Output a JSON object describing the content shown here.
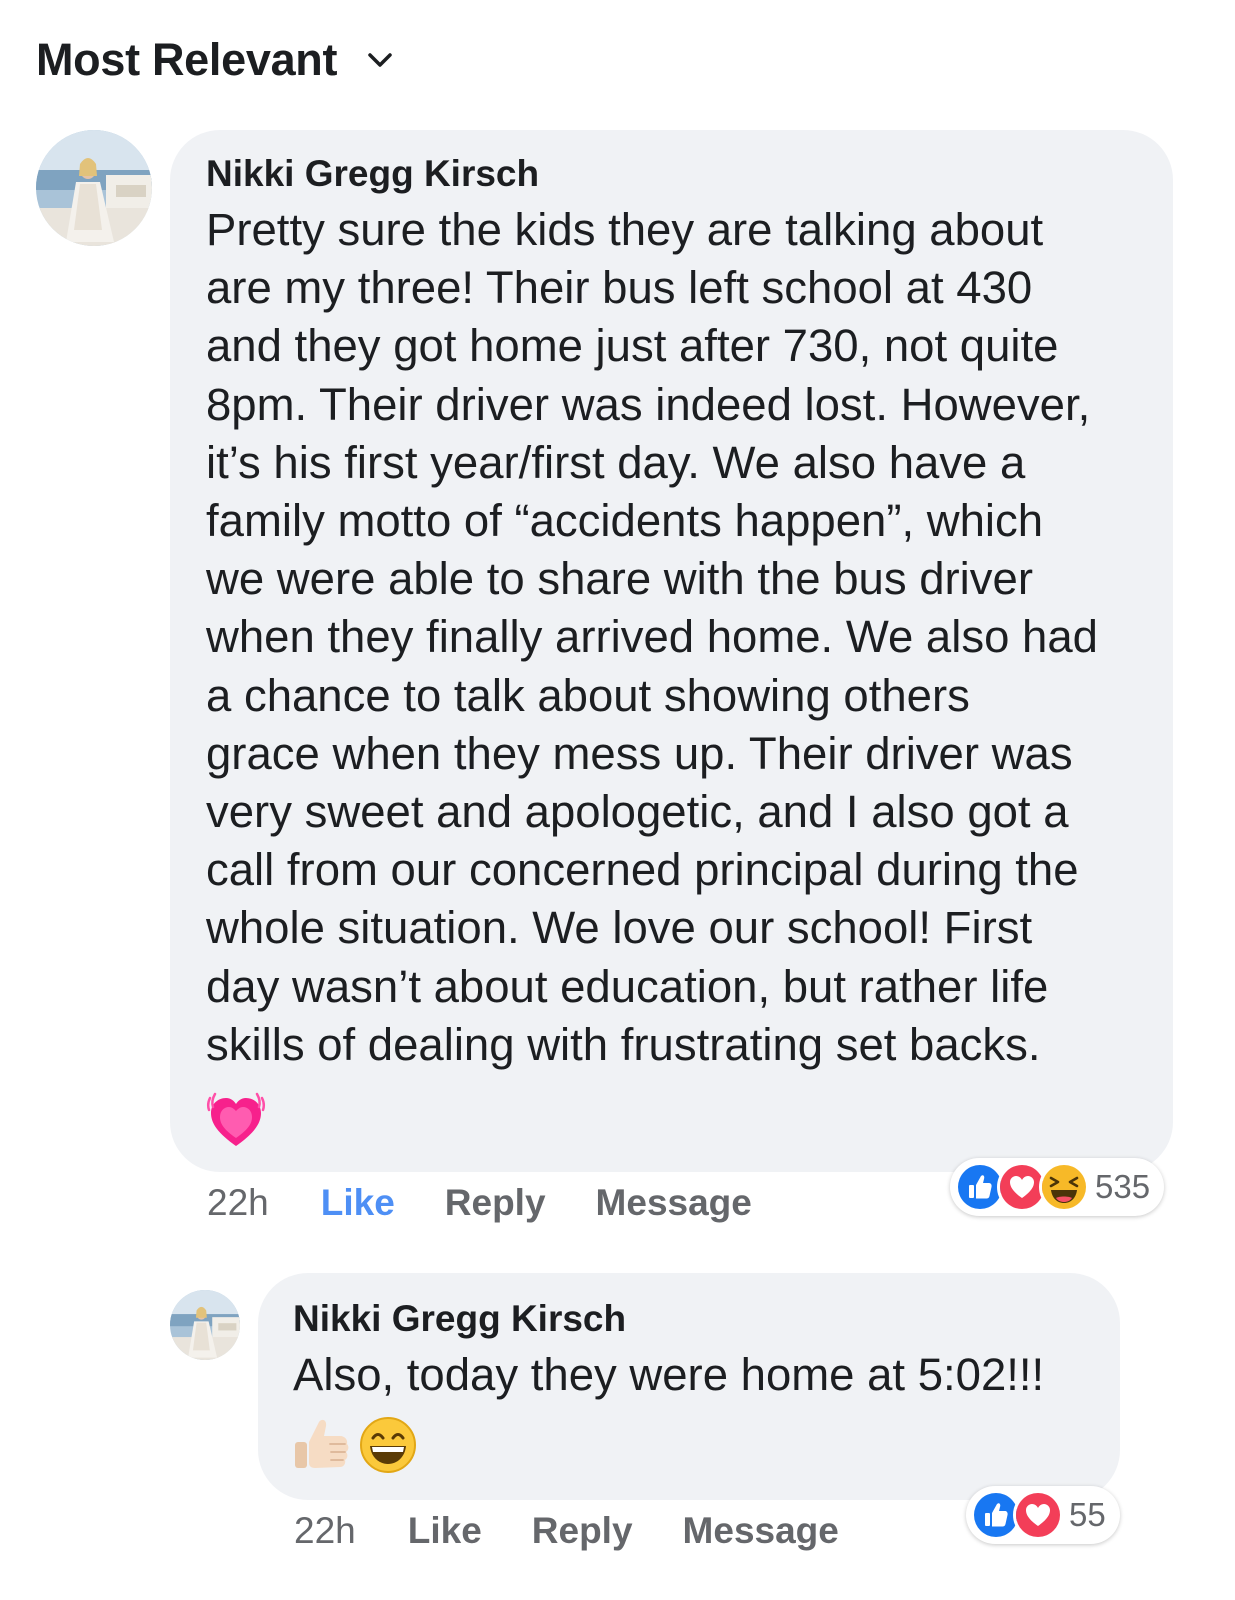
{
  "sort": {
    "label": "Most Relevant",
    "icon": "chevron-down-icon"
  },
  "comments": [
    {
      "author": "Nikki Gregg Kirsch",
      "lines": [
        "Pretty sure the kids they are talking about",
        "are my three! Their bus left school at 430",
        "and they got home just after 730, not quite",
        "8pm. Their driver was indeed lost. However,",
        "it’s his first year/first day. We also have a",
        "family motto of “accidents happen”, which",
        "we were able to share with the bus driver",
        "when they finally arrived home. We also had",
        "a chance to talk about showing others",
        "grace when they mess up. Their driver was",
        "very sweet and apologetic, and I also got a",
        "call from our concerned principal during the",
        "whole situation. We love our school! First",
        "day wasn’t about education, but rather life",
        "skills of dealing with frustrating set backs."
      ],
      "emojis": [
        "growing-heart-icon"
      ],
      "time": "22h",
      "like": "Like",
      "reply": "Reply",
      "message": "Message",
      "liked": true,
      "reactions": [
        "like-reaction-icon",
        "love-reaction-icon",
        "haha-reaction-icon"
      ],
      "reaction_count": "535"
    },
    {
      "author": "Nikki Gregg Kirsch",
      "lines": [
        "Also, today they were home at 5:02!!!"
      ],
      "emojis": [
        "thumbs-up-icon",
        "grinning-face-icon"
      ],
      "time": "22h",
      "like": "Like",
      "reply": "Reply",
      "message": "Message",
      "liked": false,
      "reactions": [
        "like-reaction-icon",
        "love-reaction-icon"
      ],
      "reaction_count": "55"
    }
  ],
  "colors": {
    "bubble": "#f0f2f5",
    "liked": "#4e8ff5",
    "muted": "#65676b",
    "text": "#1c1e21",
    "like_reaction": "#1877f2",
    "love_reaction": "#f33e58",
    "haha_reaction": "#f7b928"
  }
}
